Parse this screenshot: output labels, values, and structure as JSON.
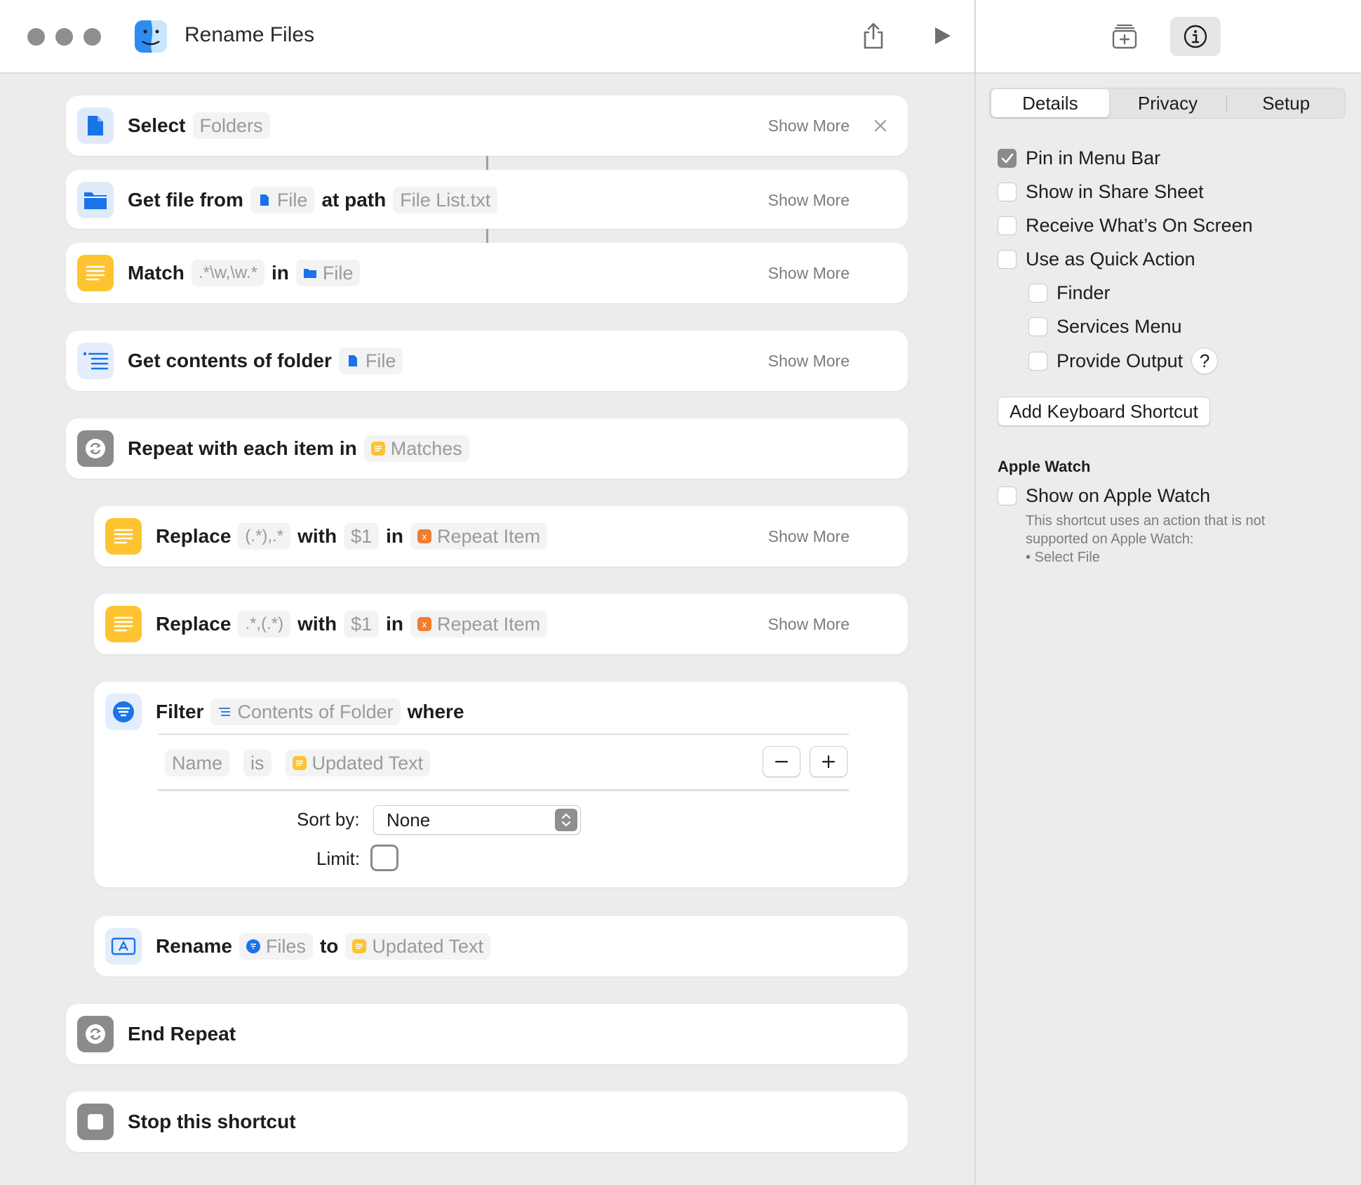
{
  "window": {
    "title": "Rename Files"
  },
  "inspector": {
    "tabs": [
      "Details",
      "Privacy",
      "Setup"
    ],
    "options": {
      "pin_menu_bar": "Pin in Menu Bar",
      "share_sheet": "Show in Share Sheet",
      "receive_screen": "Receive What’s On Screen",
      "quick_action": "Use as Quick Action",
      "finder": "Finder",
      "services_menu": "Services Menu",
      "provide_output": "Provide Output",
      "help": "?"
    },
    "add_keyboard_shortcut": "Add Keyboard Shortcut",
    "apple_watch": {
      "title": "Apple Watch",
      "show_label": "Show on Apple Watch",
      "note_line1": "This shortcut uses an action that is not",
      "note_line2": "supported on Apple Watch:",
      "note_line3": "• Select File"
    }
  },
  "actions": {
    "show_more": "Show More",
    "select": {
      "verb": "Select",
      "param": "Folders"
    },
    "get_file": {
      "verb": "Get file from",
      "param": "File",
      "mid": "at path",
      "path": "File List.txt"
    },
    "match": {
      "verb": "Match",
      "pattern": ".*\\w,\\w.*",
      "mid": "in",
      "param": "File"
    },
    "get_contents": {
      "verb": "Get contents of folder",
      "param": "File"
    },
    "repeat": {
      "verb": "Repeat with each item in",
      "param": "Matches"
    },
    "replace1": {
      "verb": "Replace",
      "pattern": "(.*),.*",
      "with": "with",
      "value": "$1",
      "in": "in",
      "param": "Repeat Item"
    },
    "replace2": {
      "verb": "Replace",
      "pattern": ".*,(.*)",
      "with": "with",
      "value": "$1",
      "in": "in",
      "param": "Repeat Item"
    },
    "filter": {
      "verb": "Filter",
      "param": "Contents of Folder",
      "where": "where",
      "cond_field": "Name",
      "cond_op": "is",
      "cond_value": "Updated Text",
      "sort_label": "Sort by:",
      "sort_value": "None",
      "limit_label": "Limit:"
    },
    "rename": {
      "verb": "Rename",
      "param": "Files",
      "to": "to",
      "value": "Updated Text"
    },
    "end_repeat": {
      "verb": "End Repeat"
    },
    "stop": {
      "verb": "Stop this shortcut"
    }
  }
}
